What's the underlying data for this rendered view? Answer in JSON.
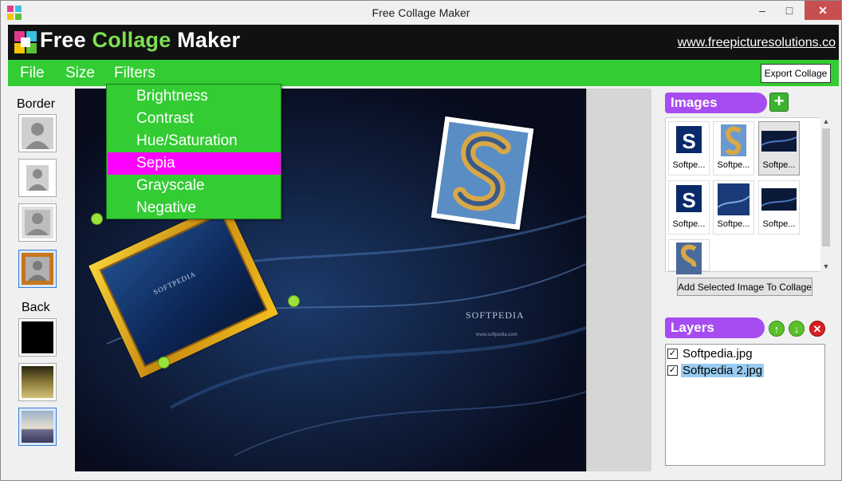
{
  "window": {
    "title": "Free Collage Maker",
    "min_glyph": "–",
    "max_glyph": "□",
    "close_glyph": "✕"
  },
  "banner": {
    "brand_free": "Free ",
    "brand_collage": "Collage",
    "brand_maker": " Maker",
    "link": "www.freepicturesolutions.co"
  },
  "menu": {
    "file": "File",
    "size": "Size",
    "filters": "Filters",
    "export": "Export Collage"
  },
  "filters_dropdown": {
    "items": [
      "Brightness",
      "Contrast",
      "Hue/Saturation",
      "Sepia",
      "Grayscale",
      "Negative"
    ],
    "highlighted": "Sepia"
  },
  "left_panel": {
    "border_label": "Border",
    "back_label": "Back"
  },
  "canvas": {
    "watermark": "SOFTPEDIA",
    "watermark_small": "www.softpedia.com"
  },
  "images_panel": {
    "title": "Images",
    "tiles": [
      {
        "caption": "Softpe..."
      },
      {
        "caption": "Softpe..."
      },
      {
        "caption": "Softpe..."
      },
      {
        "caption": "Softpe..."
      },
      {
        "caption": "Softpe..."
      },
      {
        "caption": "Softpe..."
      },
      {
        "caption": ""
      }
    ],
    "add_button": "Add Selected Image To Collage"
  },
  "layers_panel": {
    "title": "Layers",
    "layers": [
      {
        "name": "Softpedia.jpg",
        "checked": true
      },
      {
        "name": "Softpedia 2.jpg",
        "checked": true
      }
    ]
  },
  "colors": {
    "menu_green": "#33cc33",
    "highlight_magenta": "#ff00ff",
    "section_purple": "#a64cf0",
    "banner_black": "#111111"
  }
}
